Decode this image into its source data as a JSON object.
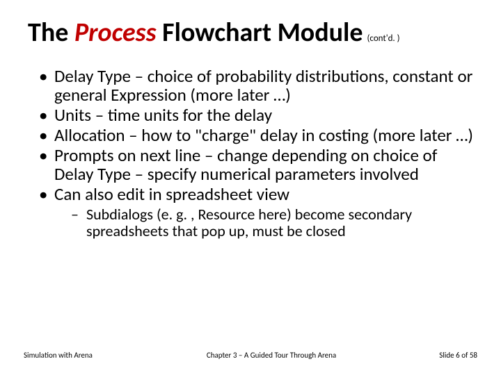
{
  "title": {
    "part1": "The ",
    "part2": "Process",
    "part3": " Flowchart Module",
    "contd": "(cont'd. )"
  },
  "bullets": [
    "Delay Type – choice of probability distributions, constant or general Expression (more later …)",
    "Units – time units for the delay",
    "Allocation – how to \"charge\" delay in costing (more later …)",
    "Prompts on next line – change depending on choice of Delay Type – specify numerical parameters involved",
    "Can also edit in spreadsheet view"
  ],
  "subbullets": [
    "Subdialogs (e. g. , Resource here) become secondary spreadsheets that pop up, must be closed"
  ],
  "footer": {
    "left": "Simulation with Arena",
    "center": "Chapter 3 – A Guided Tour Through Arena",
    "right": "Slide 6 of 58"
  }
}
